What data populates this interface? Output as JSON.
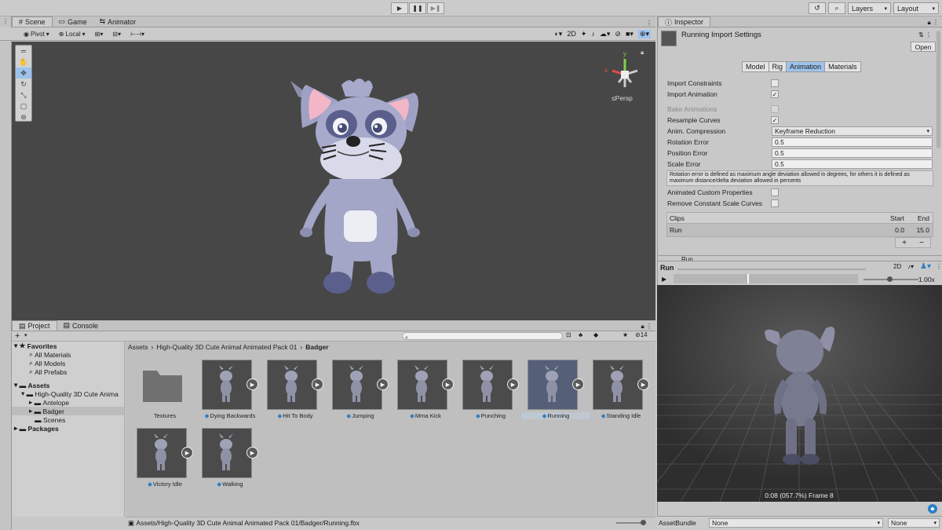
{
  "toolbar": {
    "play": "▶",
    "pause": "❚❚",
    "step": "▶❚",
    "history": "↺",
    "layers": "Layers",
    "layout": "Layout"
  },
  "scene_tabs": [
    {
      "label": "Scene",
      "icon": "scene-icon"
    },
    {
      "label": "Game",
      "icon": "game-icon"
    },
    {
      "label": "Animator",
      "icon": "animator-icon"
    }
  ],
  "scene_toolbar": {
    "pivot": "Pivot",
    "local": "Local",
    "mode_2d": "2D"
  },
  "gizmo": {
    "persp": "≤Persp",
    "x": "x",
    "y": "y"
  },
  "project_tabs": [
    {
      "label": "Project",
      "icon": "folder-icon"
    },
    {
      "label": "Console",
      "icon": "console-icon"
    }
  ],
  "project_toolbar": {
    "add": "+",
    "count": "14"
  },
  "tree": {
    "favorites": "Favorites",
    "fav_items": [
      "All Materials",
      "All Models",
      "All Prefabs"
    ],
    "assets": "Assets",
    "pack": "High-Quality 3D Cute Anima",
    "antelope": "Antelope",
    "badger": "Badger",
    "scenes": "Scenes",
    "packages": "Packages"
  },
  "breadcrumb": [
    "Assets",
    "High-Quality 3D Cute Animal Animated Pack 01",
    "Badger"
  ],
  "assets": [
    {
      "label": "Textures",
      "type": "folder"
    },
    {
      "label": "Dying Backwards",
      "type": "model"
    },
    {
      "label": "Hit To Body",
      "type": "model"
    },
    {
      "label": "Jumping",
      "type": "model"
    },
    {
      "label": "Mma Kick",
      "type": "model"
    },
    {
      "label": "Punching",
      "type": "model"
    },
    {
      "label": "Running",
      "type": "model",
      "selected": true
    },
    {
      "label": "Standing Idle",
      "type": "model"
    },
    {
      "label": "Victory Idle",
      "type": "model"
    },
    {
      "label": "Walking",
      "type": "model"
    }
  ],
  "status_path": "Assets/High-Quality 3D Cute Animal Animated Pack 01/Badger/Running.fbx",
  "inspector": {
    "tab": "Inspector",
    "title": "Running Import Settings",
    "open": "Open",
    "subtabs": [
      "Model",
      "Rig",
      "Animation",
      "Materials"
    ],
    "active_subtab": "Animation",
    "rows": {
      "import_constraints": "Import Constraints",
      "import_animation": "Import Animation",
      "bake_animations": "Bake Animations",
      "resample_curves": "Resample Curves",
      "anim_compression": "Anim. Compression",
      "anim_compression_value": "Keyframe Reduction",
      "rotation_error": "Rotation Error",
      "rotation_error_value": "0.5",
      "position_error": "Position Error",
      "position_error_value": "0.5",
      "scale_error": "Scale Error",
      "scale_error_value": "0.5",
      "help": "Rotation error is defined as maximum angle deviation allowed in degrees, for others it is defined as maximum distance/delta deviation allowed in percents",
      "animated_custom": "Animated Custom Properties",
      "remove_constant": "Remove Constant Scale Curves"
    },
    "checks": {
      "import_constraints": false,
      "import_animation": true,
      "bake_animations": false,
      "resample_curves": true,
      "animated_custom": false,
      "remove_constant": false
    },
    "clips": {
      "header": "Clips",
      "start": "Start",
      "end": "End",
      "rows": [
        {
          "name": "Run",
          "start": "0.0",
          "end": "15.0"
        }
      ],
      "add": "+",
      "remove": "−"
    },
    "partial": "Run"
  },
  "preview": {
    "title": "Run",
    "mode_2d": "2D",
    "speed": "1.00x",
    "play": "▶",
    "timer": "0:08 (057.7%) Frame 8",
    "scrub": 0.4
  },
  "bottom": {
    "assetbundle": "AssetBundle",
    "none1": "None",
    "none2": "None"
  },
  "colors": {
    "accent": "#9dc3ec",
    "scene_bg": "#474747",
    "preview_bg": "#3a3a3a"
  }
}
